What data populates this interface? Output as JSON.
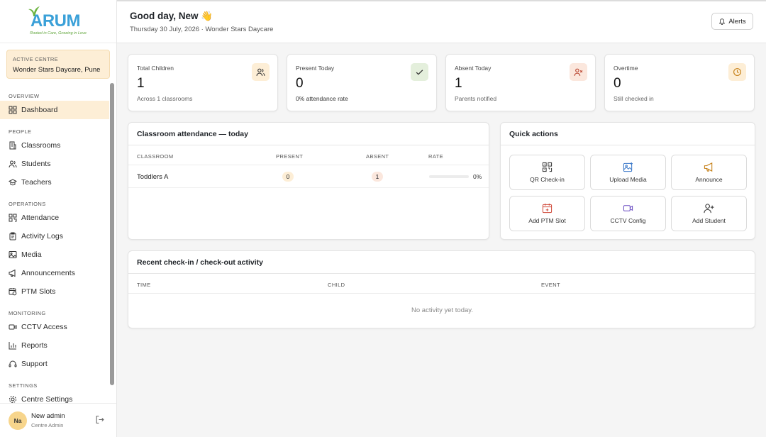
{
  "app": {
    "logo_text": "ARUM",
    "logo_tagline": "Rooted in Care, Growing in Love"
  },
  "sidebar": {
    "active_centre_label": "ACTIVE CENTRE",
    "active_centre_value": "Wonder Stars Daycare, Pune",
    "sections": {
      "overview": "OVERVIEW",
      "people": "PEOPLE",
      "operations": "OPERATIONS",
      "monitoring": "MONITORING",
      "settings": "SETTINGS"
    },
    "items": {
      "dashboard": "Dashboard",
      "classrooms": "Classrooms",
      "students": "Students",
      "teachers": "Teachers",
      "attendance": "Attendance",
      "activity_logs": "Activity Logs",
      "media": "Media",
      "announcements": "Announcements",
      "ptm_slots": "PTM Slots",
      "cctv_access": "CCTV Access",
      "reports": "Reports",
      "support": "Support",
      "centre_settings": "Centre Settings"
    },
    "user": {
      "initials": "Na",
      "name": "New admin",
      "role": "Centre Admin"
    }
  },
  "header": {
    "greeting": "Good day, New 👋",
    "subline": "Thursday 30 July, 2026 · Wonder Stars Daycare",
    "alerts_label": "Alerts"
  },
  "stats": [
    {
      "title": "Total Children",
      "value": "1",
      "sub": "Across 1 classrooms",
      "icon": "users-icon",
      "icon_bg": "#fdeed6",
      "icon_color": "#333333"
    },
    {
      "title": "Present Today",
      "value": "0",
      "sub": "0% attendance rate",
      "icon": "check-icon",
      "icon_bg": "#e4efdc",
      "icon_color": "#333333"
    },
    {
      "title": "Absent Today",
      "value": "1",
      "sub": "Parents notified",
      "icon": "user-x-icon",
      "icon_bg": "#fbe7dd",
      "icon_color": "#b8412c"
    },
    {
      "title": "Overtime",
      "value": "0",
      "sub": "Still checked in",
      "icon": "clock-icon",
      "icon_bg": "#fdeed6",
      "icon_color": "#c47c10"
    }
  ],
  "attendance": {
    "title": "Classroom attendance — today",
    "columns": [
      "CLASSROOM",
      "PRESENT",
      "ABSENT",
      "RATE"
    ],
    "rows": [
      {
        "classroom": "Toddlers A",
        "present": "0",
        "absent": "1",
        "rate_text": "0%",
        "rate": 0
      }
    ]
  },
  "quick_actions": {
    "title": "Quick actions",
    "items": [
      {
        "label": "QR Check-in",
        "icon": "qr-code-icon",
        "color": "#333333"
      },
      {
        "label": "Upload Media",
        "icon": "image-upload-icon",
        "color": "#3a78c9"
      },
      {
        "label": "Announce",
        "icon": "megaphone-icon",
        "color": "#c47c10"
      },
      {
        "label": "Add PTM Slot",
        "icon": "calendar-plus-icon",
        "color": "#d04a3a"
      },
      {
        "label": "CCTV Config",
        "icon": "video-icon",
        "color": "#6a4cc2"
      },
      {
        "label": "Add Student",
        "icon": "user-plus-icon",
        "color": "#333333"
      }
    ]
  },
  "recent": {
    "title": "Recent check-in / check-out activity",
    "columns": [
      "TIME",
      "CHILD",
      "EVENT"
    ],
    "empty_text": "No activity yet today."
  },
  "colors": {
    "accent": "#f0a020",
    "active_bg": "#fdeed6",
    "present_pill": "#fdeed6",
    "absent_pill": "#fbe7dd"
  }
}
